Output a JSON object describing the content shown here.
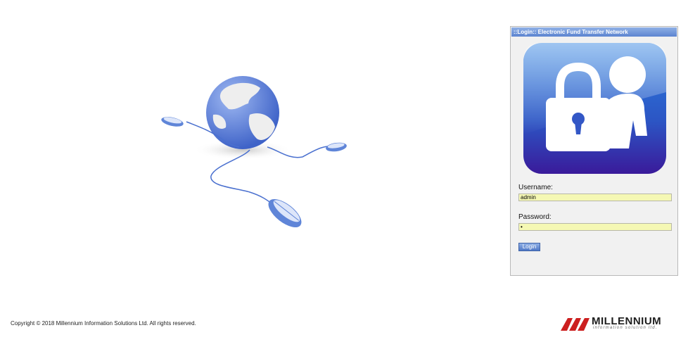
{
  "login": {
    "title": "::Login:: Electronic Fund Transfer Network",
    "username_label": "Username:",
    "username_value": "admin",
    "password_label": "Password:",
    "password_value": "•",
    "button_label": "Login"
  },
  "footer": {
    "copyright": "Copyright © 2018 Millennium Information Solutions Ltd. All rights reserved.",
    "brand_name": "MILLENNIUM",
    "brand_tagline": "information solution ltd."
  },
  "colors": {
    "accent": "#5c84d0",
    "input_bg": "#f5f8b4",
    "badge_top": "#2a7fe0",
    "badge_bottom": "#3a1a9a",
    "brand_red": "#cc1f1f"
  },
  "icons": {
    "hero": "globe-network-icon",
    "badge": "lock-user-icon",
    "brand": "millennium-logo-icon"
  }
}
